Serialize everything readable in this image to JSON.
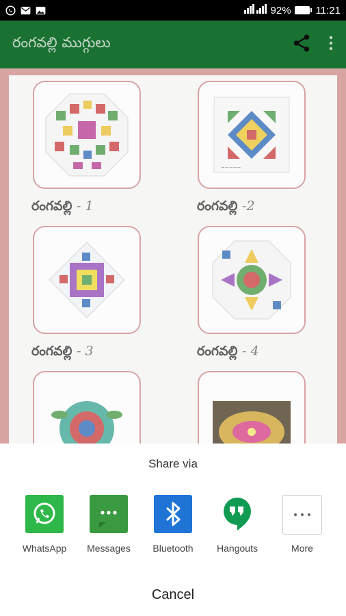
{
  "status_bar": {
    "battery": "92%",
    "time": "11:21",
    "left_icons": [
      "whatsapp-icon",
      "mail-icon",
      "image-icon"
    ]
  },
  "app_bar": {
    "title": "రంగవల్లి ముగ్గులు",
    "actions": [
      "share-icon",
      "more-vert-icon"
    ]
  },
  "grid": {
    "items": [
      {
        "label": "రంగవల్లి",
        "num": "- 1"
      },
      {
        "label": "రంగవల్లి",
        "num": "-2"
      },
      {
        "label": "రంగవల్లి",
        "num": "- 3"
      },
      {
        "label": "రంగవల్లి",
        "num": "- 4"
      },
      {
        "label": "",
        "num": ""
      },
      {
        "label": "",
        "num": ""
      }
    ]
  },
  "share_sheet": {
    "title": "Share via",
    "apps": [
      {
        "label": "WhatsApp",
        "icon": "whatsapp-icon",
        "color": "#2fb84a"
      },
      {
        "label": "Messages",
        "icon": "messages-icon",
        "color": "#3a9a40"
      },
      {
        "label": "Bluetooth",
        "icon": "bluetooth-icon",
        "color": "#1f74d6"
      },
      {
        "label": "Hangouts",
        "icon": "hangouts-icon",
        "color": "#119b52"
      },
      {
        "label": "More",
        "icon": "more-icon",
        "color": "#ffffff"
      }
    ],
    "cancel_label": "Cancel"
  }
}
